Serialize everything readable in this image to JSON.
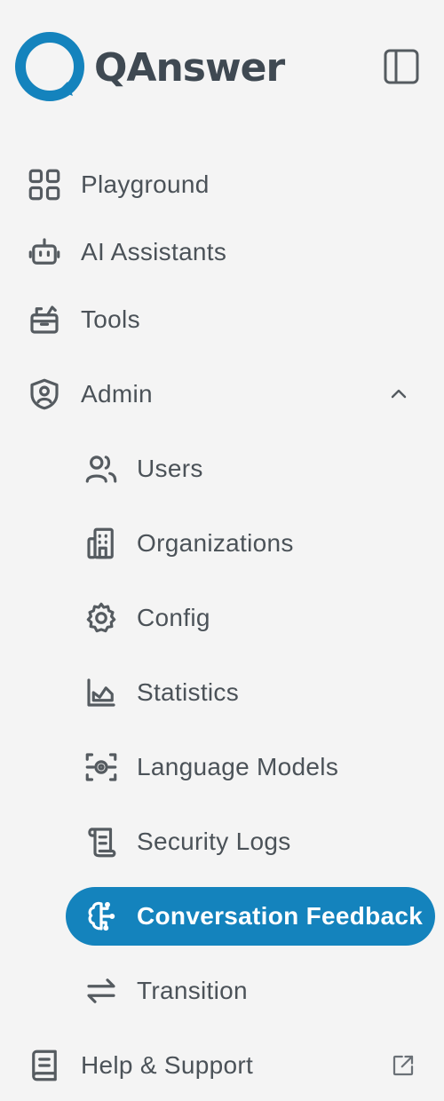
{
  "app": {
    "name": "QAnswer",
    "brand_color": "#1483bd",
    "logo_icon": "speech-bubble-q-logo",
    "panel_toggle_icon": "sidebar-panel-icon"
  },
  "nav": {
    "playground": {
      "label": "Playground",
      "icon": "grid-icon"
    },
    "assistants": {
      "label": "AI Assistants",
      "icon": "robot-icon"
    },
    "tools": {
      "label": "Tools",
      "icon": "toolbox-icon"
    },
    "admin": {
      "label": "Admin",
      "icon": "shield-user-icon",
      "expanded": true,
      "items": [
        {
          "label": "Users",
          "icon": "users-icon"
        },
        {
          "label": "Organizations",
          "icon": "building-icon"
        },
        {
          "label": "Config",
          "icon": "gear-icon"
        },
        {
          "label": "Statistics",
          "icon": "chart-icon"
        },
        {
          "label": "Language Models",
          "icon": "model-settings-icon"
        },
        {
          "label": "Security Logs",
          "icon": "scroll-icon"
        },
        {
          "label": "Conversation Feedback",
          "icon": "brain-icon",
          "active": true
        },
        {
          "label": "Transition",
          "icon": "arrows-swap-icon"
        }
      ]
    },
    "help": {
      "label": "Help & Support",
      "icon": "book-icon",
      "external_icon": "external-link-icon"
    }
  }
}
